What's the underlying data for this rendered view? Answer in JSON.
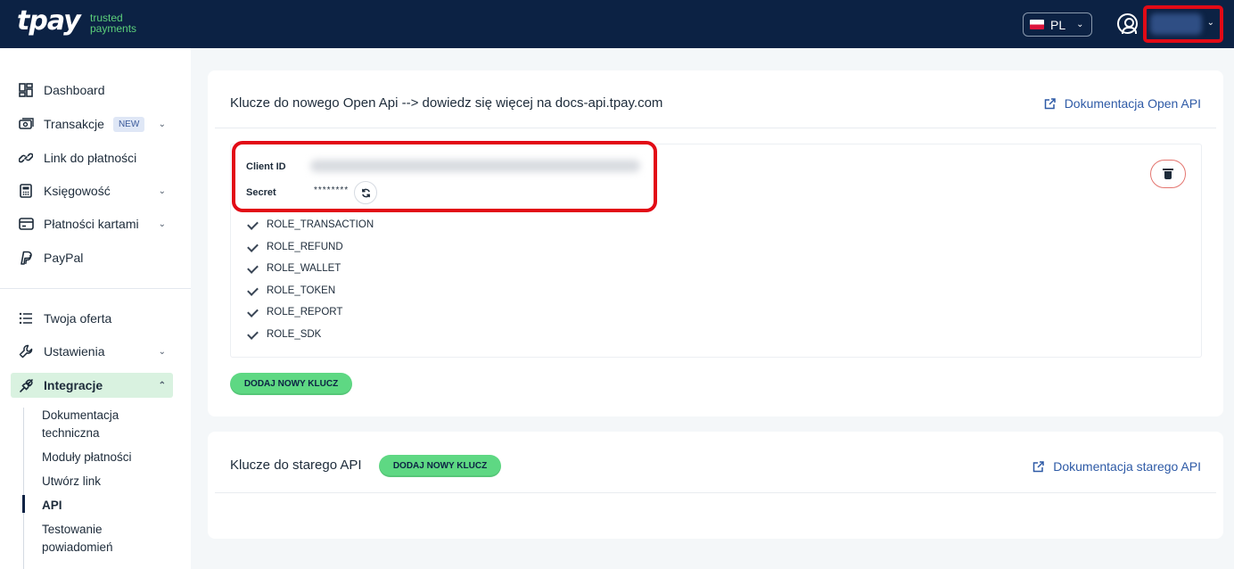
{
  "header": {
    "logo": "tpay",
    "tagline_line1": "trusted",
    "tagline_line2": "payments",
    "language": "PL"
  },
  "sidebar": {
    "items": [
      {
        "label": "Dashboard",
        "icon": "dashboard-icon"
      },
      {
        "label": "Transakcje",
        "badge": "NEW",
        "icon": "transactions-icon"
      },
      {
        "label": "Link do płatności",
        "icon": "link-icon"
      },
      {
        "label": "Księgowość",
        "icon": "calculator-icon"
      },
      {
        "label": "Płatności kartami",
        "icon": "card-icon"
      },
      {
        "label": "PayPal",
        "icon": "paypal-icon"
      },
      {
        "label": "Twoja oferta",
        "icon": "list-icon"
      },
      {
        "label": "Ustawienia",
        "icon": "wrench-icon"
      },
      {
        "label": "Integracje",
        "icon": "plug-icon"
      }
    ],
    "sub_items": [
      {
        "line1": "Dokumentacja",
        "line2": "techniczna"
      },
      {
        "line1": "Moduły płatności"
      },
      {
        "line1": "Utwórz link"
      },
      {
        "line1": "API"
      },
      {
        "line1": "Testowanie",
        "line2": "powiadomień"
      }
    ]
  },
  "open_api": {
    "title": "Klucze do nowego Open Api --> dowiedz się więcej na docs-api.tpay.com",
    "doc_link": "Dokumentacja Open API",
    "client_id_label": "Client ID",
    "secret_label": "Secret",
    "secret_value": "********",
    "roles": [
      "ROLE_TRANSACTION",
      "ROLE_REFUND",
      "ROLE_WALLET",
      "ROLE_TOKEN",
      "ROLE_REPORT",
      "ROLE_SDK"
    ],
    "add_key_label": "DODAJ NOWY KLUCZ"
  },
  "old_api": {
    "title": "Klucze do starego API",
    "add_key_label": "DODAJ NOWY KLUCZ",
    "doc_link": "Dokumentacja starego API"
  },
  "colors": {
    "header_bg": "#0c2244",
    "accent_green": "#5ed883",
    "link_blue": "#2e5aa6",
    "highlight_red": "#e20a16"
  }
}
